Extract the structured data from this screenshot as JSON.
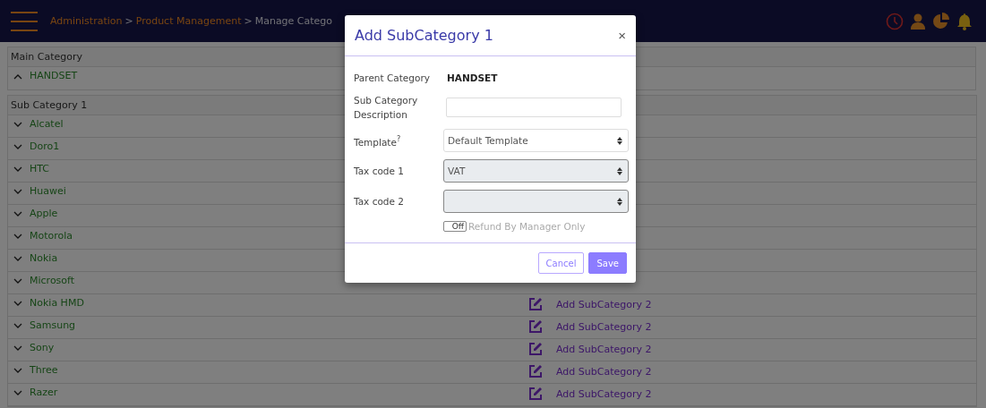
{
  "header": {
    "breadcrumbs": [
      {
        "label": "Administration",
        "kind": "link"
      },
      {
        "label": "Product Management",
        "kind": "link"
      },
      {
        "label": "Manage Catego",
        "kind": "current"
      }
    ],
    "separator": ">"
  },
  "main_category": {
    "heading": "Main Category",
    "name": "HANDSET",
    "expanded": true
  },
  "sub_category": {
    "heading": "Sub Category 1",
    "rows": [
      {
        "name": "Alcatel",
        "expanded": false
      },
      {
        "name": "Doro1",
        "expanded": false
      },
      {
        "name": "HTC",
        "expanded": false
      },
      {
        "name": "Huawei",
        "expanded": false
      },
      {
        "name": "Apple",
        "expanded": false
      },
      {
        "name": "Motorola",
        "expanded": false
      },
      {
        "name": "Nokia",
        "expanded": false
      },
      {
        "name": "Microsoft",
        "expanded": false
      },
      {
        "name": "Nokia HMD",
        "expanded": false,
        "action": "Add SubCategory 2"
      },
      {
        "name": "Samsung",
        "expanded": false,
        "action": "Add SubCategory 2"
      },
      {
        "name": "Sony",
        "expanded": false,
        "action": "Add SubCategory 2"
      },
      {
        "name": "Three",
        "expanded": false,
        "action": "Add SubCategory 2"
      },
      {
        "name": "Razer",
        "expanded": false,
        "action": "Add SubCategory 2"
      }
    ]
  },
  "dialog": {
    "title": "Add SubCategory 1",
    "close": "×",
    "fields": [
      {
        "kind": "static",
        "label": "Parent Category",
        "value": "HANDSET"
      },
      {
        "kind": "text",
        "label": "Sub Category Description"
      },
      {
        "kind": "select",
        "label": "Template",
        "help": "?",
        "value": "Default Template",
        "disabled": false
      },
      {
        "kind": "select",
        "label": "Tax code 1",
        "value": "VAT",
        "disabled": true
      },
      {
        "kind": "select",
        "label": "Tax code 2",
        "disabled": true
      },
      {
        "kind": "toggle",
        "label": "Refund By Manager Only",
        "state_text": "Off",
        "on": false
      }
    ],
    "buttons": [
      {
        "label": "Cancel",
        "kind": "secondary"
      },
      {
        "label": "Save",
        "kind": "primary"
      }
    ]
  }
}
